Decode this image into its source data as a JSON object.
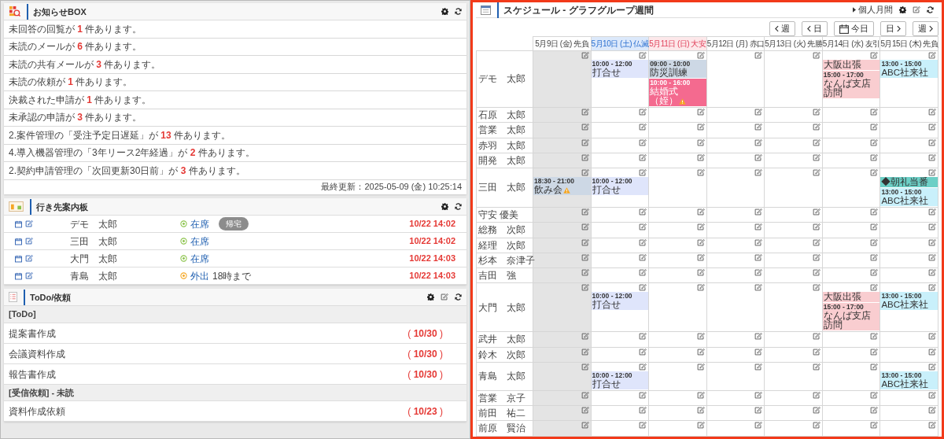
{
  "notices": {
    "title": "お知らせBOX",
    "items": [
      {
        "text": "未回答の回覧が **1** 件あります。"
      },
      {
        "text": "未読のメールが **6** 件あります。"
      },
      {
        "text": "未読の共有メールが **3** 件あります。"
      },
      {
        "text": "未読の依頼が **1** 件あります。"
      },
      {
        "text": "決裁された申請が **1** 件あります。"
      },
      {
        "text": "未承認の申請が **3** 件あります。"
      },
      {
        "text": "2.案件管理の「受注予定日遅延」が **13** 件あります。"
      },
      {
        "text": "4.導入機器管理の「3年リース2年経過」が **2** 件あります。"
      },
      {
        "text": "2.契約申請管理の「次回更新30日前」が **3** 件あります。"
      }
    ],
    "updated": "最終更新：2025-05-09 (金) 10:25:14"
  },
  "location": {
    "title": "行き先案内板",
    "rows": [
      {
        "name": "デモ　太郎",
        "kind": "in",
        "status": "在席",
        "action": "帰宅",
        "time": "10/22 14:02"
      },
      {
        "name": "三田　太郎",
        "kind": "in",
        "status": "在席",
        "time": "10/22 14:02"
      },
      {
        "name": "大門　太郎",
        "kind": "in",
        "status": "在席",
        "time": "10/22 14:03"
      },
      {
        "name": "青島　太郎",
        "kind": "out",
        "status": "外出",
        "note": "18時まで",
        "time": "10/22 14:03"
      }
    ]
  },
  "todo": {
    "title": "ToDo/依頼",
    "sections": [
      {
        "title": "[ToDo]",
        "items": [
          {
            "title": "提案書作成",
            "due": "( **10/30** )"
          },
          {
            "title": "会議資料作成",
            "due": "( **10/30** )"
          },
          {
            "title": "報告書作成",
            "due": "( **10/30** )"
          }
        ]
      },
      {
        "title": "[受信依頼] - 未読",
        "items": [
          {
            "title": "資料作成依頼",
            "due": "( **10/23** )"
          }
        ]
      }
    ]
  },
  "schedule": {
    "title": "スケジュール - グラフグループ週間",
    "link": "個人月間",
    "nav": [
      {
        "kind": "prev",
        "label": "週"
      },
      {
        "kind": "prev",
        "label": "日"
      },
      {
        "kind": "today",
        "label": "今日"
      },
      {
        "kind": "next",
        "label": "日"
      },
      {
        "kind": "next",
        "label": "週"
      }
    ],
    "days": [
      {
        "label": "5月9日 (金) 先負",
        "kind": "weekday",
        "today": true
      },
      {
        "label": "5月10日 (土) 仏滅",
        "kind": "saturday",
        "today": false
      },
      {
        "label": "5月11日 (日) 大安",
        "kind": "sunday",
        "today": false
      },
      {
        "label": "5月12日 (月) 赤口",
        "kind": "weekday",
        "today": false
      },
      {
        "label": "5月13日 (火) 先勝",
        "kind": "weekday",
        "today": false
      },
      {
        "label": "5月14日 (水) 友引",
        "kind": "weekday",
        "today": false
      },
      {
        "label": "5月15日 (木) 先負",
        "kind": "weekday",
        "today": false
      }
    ],
    "members": [
      {
        "name": "デモ　太郎",
        "cells": [
          {},
          {
            "events": [
              {
                "time": "10:00 - 12:00",
                "title": "打合せ",
                "color": "#dfe5fb",
                "warning": false
              }
            ]
          },
          {
            "events": [
              {
                "time": "09:00 - 10:00",
                "title": "防災訓練",
                "color": "#cdd8e5",
                "warning": false
              },
              {
                "time": "10:00 - 16:00",
                "title": "結婚式（姪）",
                "color": "#f46a8f",
                "warning": true
              }
            ]
          },
          {},
          {},
          {
            "events": [
              {
                "title": "大阪出張",
                "color": "#f9cdd0",
                "warning": false
              },
              {
                "time": "15:00 - 17:00",
                "title": "なんば支店訪問",
                "color": "#f9cdd0",
                "warning": false
              }
            ]
          },
          {
            "events": [
              {
                "time": "13:00 - 15:00",
                "title": "ABC社来社",
                "color": "#c9f0fb",
                "warning": false
              }
            ]
          }
        ]
      },
      {
        "name": "石原　太郎"
      },
      {
        "name": "営業　太郎"
      },
      {
        "name": "赤羽　太郎"
      },
      {
        "name": "開発　太郎"
      },
      {
        "name": "三田　太郎",
        "cells": [
          {
            "events": [
              {
                "time": "18:30 - 21:00",
                "title": "飲み会",
                "color": "#cdd8e5",
                "warning": true
              }
            ]
          },
          {
            "events": [
              {
                "time": "10:00 - 12:00",
                "title": "打合せ",
                "color": "#dfe5fb",
                "warning": false
              }
            ]
          },
          {},
          {},
          {},
          {},
          {
            "events": [
              {
                "title": "◆朝礼当番",
                "color": "#6ccfc6",
                "warning": false
              },
              {
                "time": "13:00 - 15:00",
                "title": "ABC社来社",
                "color": "#c9f0fb",
                "warning": false
              }
            ]
          }
        ]
      },
      {
        "name": "守安 優美"
      },
      {
        "name": "総務　次郎"
      },
      {
        "name": "経理　次郎"
      },
      {
        "name": "杉本　奈津子"
      },
      {
        "name": "吉田　強"
      },
      {
        "name": "大門　太郎",
        "cells": [
          {},
          {
            "events": [
              {
                "time": "10:00 - 12:00",
                "title": "打合せ",
                "color": "#dfe5fb",
                "warning": false
              }
            ]
          },
          {},
          {},
          {},
          {
            "events": [
              {
                "title": "大阪出張",
                "color": "#f9cdd0",
                "warning": false
              },
              {
                "time": "15:00 - 17:00",
                "title": "なんば支店訪問",
                "color": "#f9cdd0",
                "warning": false
              }
            ]
          },
          {
            "events": [
              {
                "time": "13:00 - 15:00",
                "title": "ABC社来社",
                "color": "#c9f0fb",
                "warning": false
              }
            ]
          }
        ]
      },
      {
        "name": "武井　太郎"
      },
      {
        "name": "鈴木　次郎"
      },
      {
        "name": "青島　太郎",
        "cells": [
          {},
          {
            "events": [
              {
                "time": "10:00 - 12:00",
                "title": "打合せ",
                "color": "#dfe5fb",
                "warning": false
              }
            ]
          },
          {},
          {},
          {},
          {},
          {
            "events": [
              {
                "time": "13:00 - 15:00",
                "title": "ABC社来社",
                "color": "#c9f0fb",
                "warning": false
              }
            ]
          }
        ]
      },
      {
        "name": "営業　京子"
      },
      {
        "name": "前田　祐二"
      },
      {
        "name": "前原　賢治"
      }
    ]
  }
}
